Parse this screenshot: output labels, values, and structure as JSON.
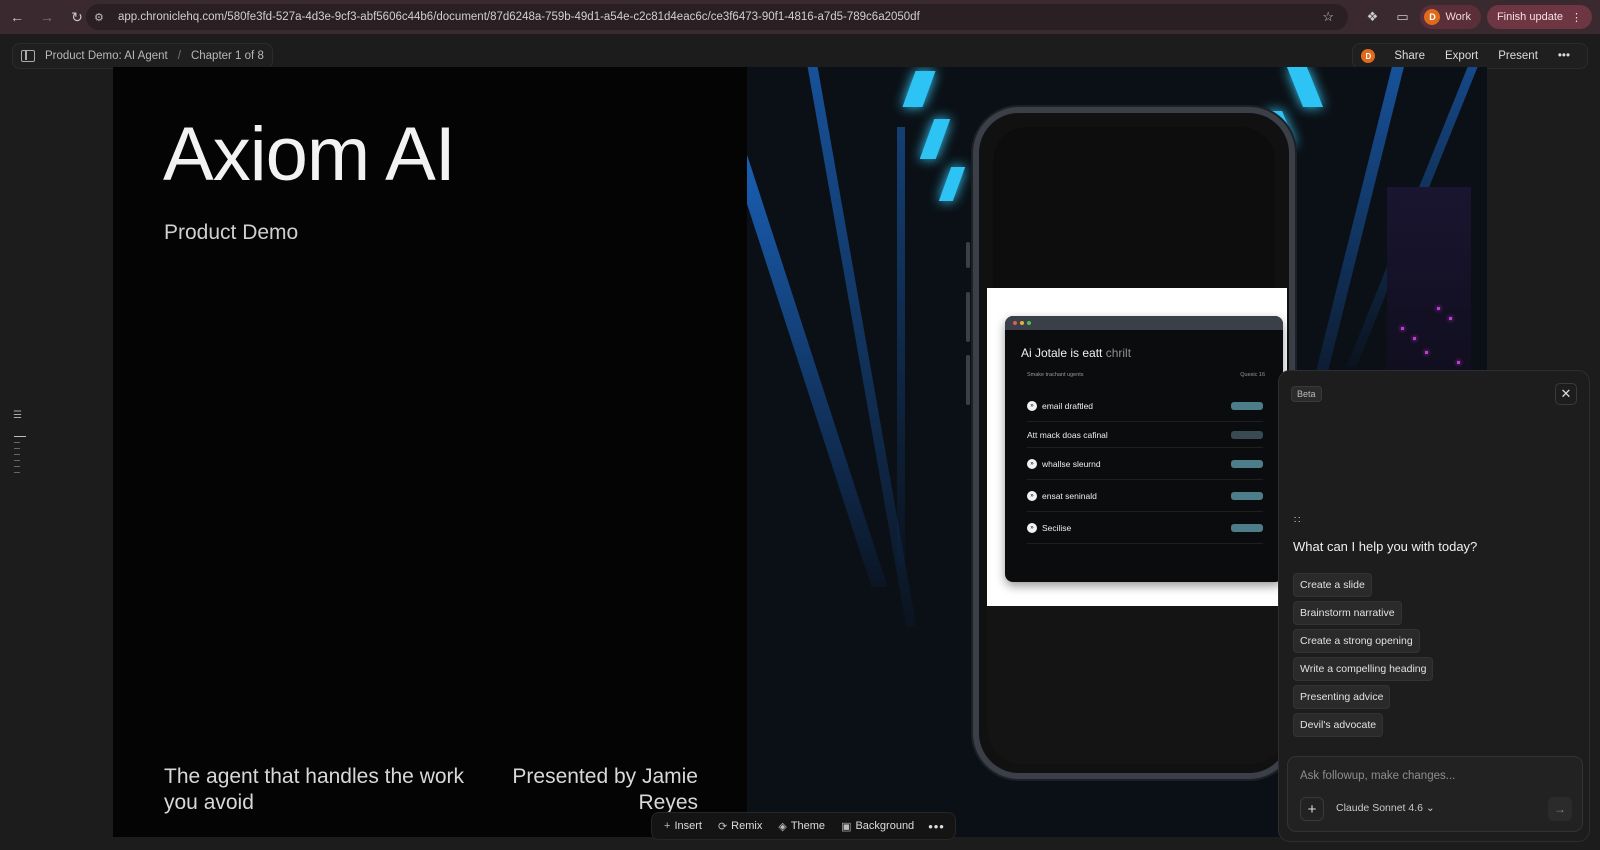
{
  "browser": {
    "url": "app.chroniclehq.com/580fe3fd-527a-4d3e-9cf3-abf5606c44b6/document/87d6248a-759b-49d1-a54e-c2c81d4eac6c/ce3f6473-90f1-4816-a7d5-789c6a2050df",
    "profile_label": "Work",
    "profile_initial": "D",
    "finish_update_label": "Finish update"
  },
  "header": {
    "breadcrumb_doc": "Product Demo: AI Agent",
    "breadcrumb_sep": "/",
    "breadcrumb_chapter": "Chapter 1 of 8",
    "avatar_initial": "D",
    "share_label": "Share",
    "export_label": "Export",
    "present_label": "Present",
    "more_label": "•••"
  },
  "slide": {
    "title": "Axiom AI",
    "subtitle": "Product Demo",
    "tagline": "The agent that handles the work you avoid",
    "presenter": "Presented by Jamie Reyes"
  },
  "phone_app": {
    "title_main": "Ai Jotale is eatt",
    "title_dim": "chrilt",
    "meta_left": "Smake trachant ugents",
    "meta_right": "Quesic 16",
    "rows": [
      {
        "label": "email draftled",
        "has_icon": true
      },
      {
        "label": "Att mack doas cafinal",
        "has_icon": false
      },
      {
        "label": "whallse sleurnd",
        "has_icon": true
      },
      {
        "label": "ensat seninald",
        "has_icon": true
      },
      {
        "label": "Secilise",
        "has_icon": true
      }
    ]
  },
  "chat": {
    "beta_label": "Beta",
    "question": "What can I help you with today?",
    "suggestions": [
      "Create a slide",
      "Brainstorm narrative",
      "Create a strong opening",
      "Write a compelling heading",
      "Presenting advice",
      "Devil's advocate"
    ],
    "input_placeholder": "Ask followup, make changes...",
    "model_label": "Claude Sonnet 4.6"
  },
  "toolbar": {
    "insert_label": "Insert",
    "remix_label": "Remix",
    "theme_label": "Theme",
    "background_label": "Background",
    "more_label": "•••"
  },
  "colors": {
    "chrome_bg": "#3a2a30",
    "app_bg": "#1c1c1c",
    "slide_bg": "#040404",
    "accent_orange": "#e06a1c",
    "pill_teal": "#4d7d88"
  }
}
